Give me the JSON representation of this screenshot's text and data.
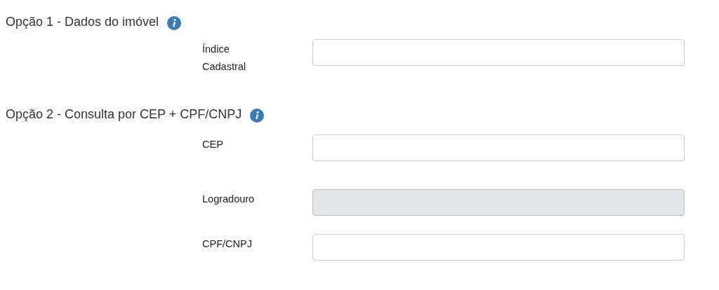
{
  "sections": [
    {
      "title": "Opção 1 - Dados do imóvel",
      "fields": [
        {
          "label": "Índice Cadastral",
          "disabled": false
        }
      ]
    },
    {
      "title": "Opção 2 - Consulta por CEP + CPF/CNPJ",
      "fields": [
        {
          "label": "CEP",
          "disabled": false
        },
        {
          "label": "Logradouro",
          "disabled": true
        },
        {
          "label": "CPF/CNPJ",
          "disabled": false
        }
      ]
    }
  ]
}
